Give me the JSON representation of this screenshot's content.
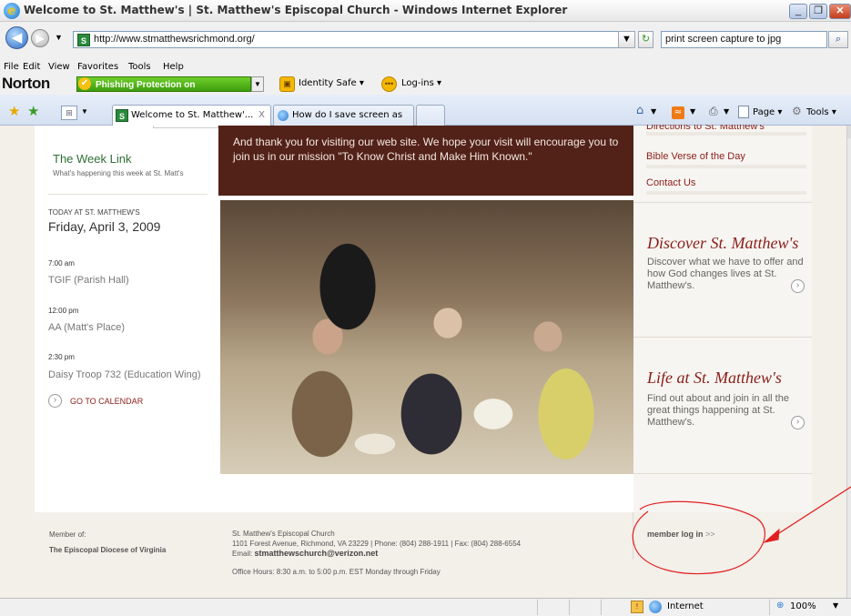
{
  "window": {
    "title": "Welcome to St. Matthew's | St. Matthew's Episcopal Church - Windows Internet Explorer"
  },
  "address": {
    "url": "http://www.stmatthewsrichmond.org/",
    "search_value": "print screen capture to jpg"
  },
  "menu": [
    "File",
    "Edit",
    "View",
    "Favorites",
    "Tools",
    "Help"
  ],
  "norton": {
    "logo": "Norton",
    "phishing": "Phishing Protection on",
    "identity": "Identity Safe ▾",
    "logins": "Log-ins ▾"
  },
  "tabs": [
    {
      "label": "Welcome to St. Matthew'...",
      "close": "X"
    },
    {
      "label": "How do I save screen as jpe..."
    }
  ],
  "commands": {
    "page": "Page ▾",
    "tools": "Tools ▾"
  },
  "page": {
    "welcome": "And thank you for visiting our web site. We hope your visit will encourage you to join us in our mission \"To Know Christ and Make Him Known.\"",
    "week_link": "The Week Link",
    "week_sub": "What's happening this week at St. Matt's",
    "today_label": "TODAY AT ST. MATTHEW'S",
    "today_date": "Friday, April 3, 2009",
    "events": [
      {
        "time": "7:00 am",
        "name": "TGIF (Parish Hall)"
      },
      {
        "time": "12:00 pm",
        "name": "AA (Matt's Place)"
      },
      {
        "time": "2:30 pm",
        "name": "Daisy Troop 732 (Education Wing)"
      }
    ],
    "calendar_link": "GO TO CALENDAR",
    "side_links": [
      "Directions to St. Matthew's",
      "Bible Verse of the Day",
      "Contact Us"
    ],
    "discover_title": "Discover St. Matthew's",
    "discover_desc": "Discover what we have to offer and how God changes lives at St. Matthew's.",
    "life_title": "Life at St. Matthew's",
    "life_desc": "Find out about and join in all the great things happening at St. Matthew's.",
    "footer": {
      "member_of": "Member of:",
      "diocese": "The Episcopal Diocese of Virginia",
      "church": "St. Matthew's Episcopal Church",
      "address": "1101 Forest Avenue, Richmond, VA 23229 | Phone: (804) 288-1911 | Fax: (804) 288-6554",
      "email_label": "Email:",
      "email": "stmatthewschurch@verizon.net",
      "hours": "Office Hours: 8:30 a.m. to 5:00 p.m. EST Monday through Friday",
      "member_login": "member log in",
      "member_login_arrows": ">>"
    }
  },
  "status": {
    "zone": "Internet",
    "zoom": "100%"
  },
  "colors": {
    "brand_brown": "#522118",
    "link_red": "#8a1e18",
    "week_green": "#2e6f35",
    "annotation_red": "#e02020"
  }
}
